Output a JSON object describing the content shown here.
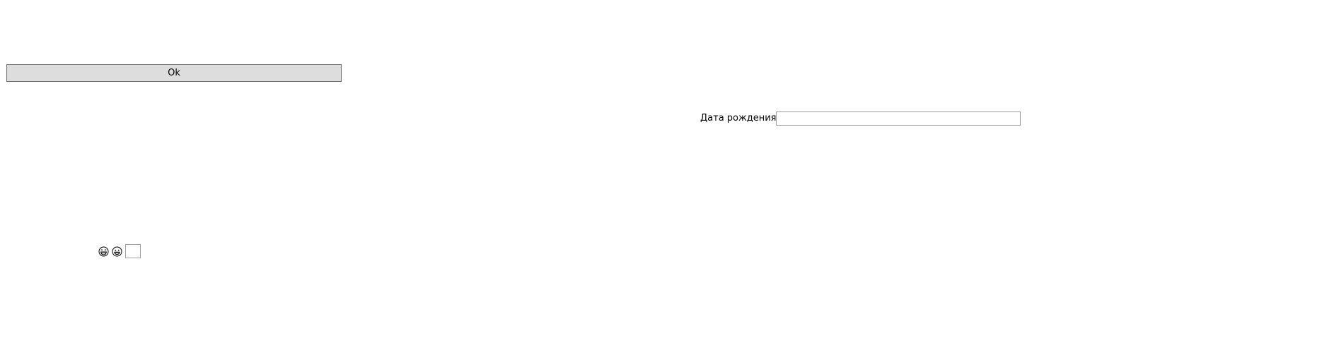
{
  "ok_button": {
    "label": "Ok"
  },
  "birth_date": {
    "label": "Дата рождения",
    "value": ""
  },
  "emoji_row": {
    "icons": [
      "laughing-face-icon",
      "grinning-face-icon"
    ],
    "input_value": ""
  },
  "colors": {
    "button_background": "#dddddd",
    "button_border": "#707070",
    "input_border": "#a0a0a0",
    "page_background": "#ffffff"
  }
}
